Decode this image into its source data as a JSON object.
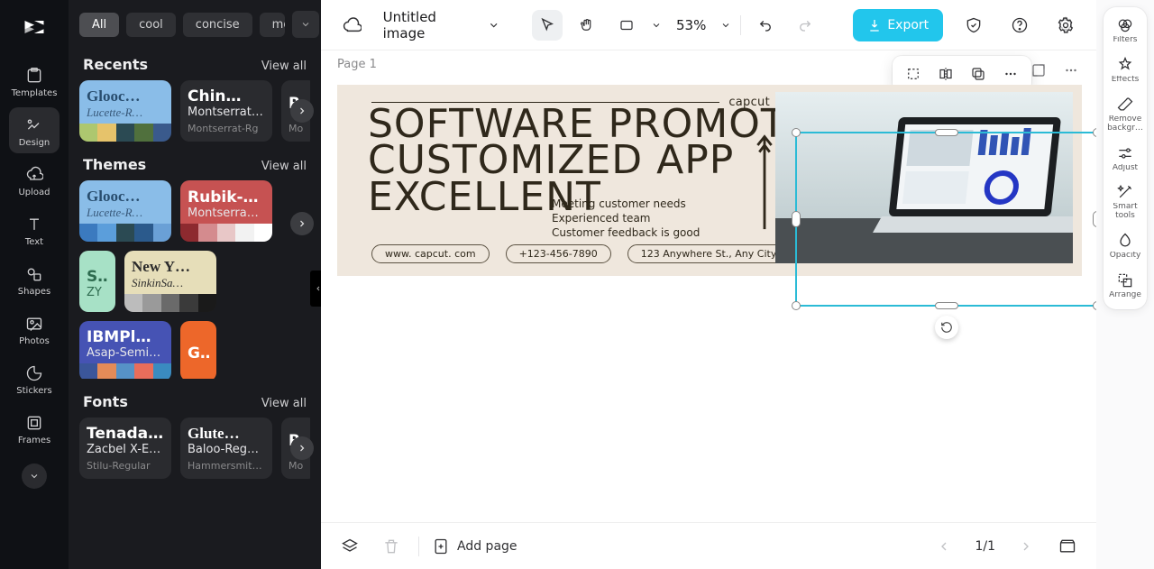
{
  "nav": {
    "items": [
      {
        "label": "Templates"
      },
      {
        "label": "Design"
      },
      {
        "label": "Upload"
      },
      {
        "label": "Text"
      },
      {
        "label": "Shapes"
      },
      {
        "label": "Photos"
      },
      {
        "label": "Stickers"
      },
      {
        "label": "Frames"
      }
    ],
    "active": "Design"
  },
  "chips": {
    "All": "All",
    "cool": "cool",
    "concise": "concise",
    "modern": "modern"
  },
  "sections": {
    "recents_title": "Recents",
    "themes_title": "Themes",
    "fonts_title": "Fonts",
    "view_all": "View all"
  },
  "recents": [
    {
      "title": "Glooc…",
      "sub": "Lucette-R…",
      "meta": "",
      "pal": [
        "#adc76f",
        "#e6c36b",
        "#2b4a53",
        "#50703d",
        "#3a5a8c"
      ]
    },
    {
      "title": "Chin…",
      "sub": "Montserrat-…",
      "meta": "Montserrat-Rg"
    },
    {
      "title": "Ru…",
      "sub": "",
      "meta": "Mo"
    }
  ],
  "themes": [
    {
      "title": "Glooc…",
      "sub": "Lucette-R…",
      "pal": [
        "#3b7abf",
        "#5b9edb",
        "#2b4a53",
        "#2b5a8c",
        "#6aa0d6"
      ]
    },
    {
      "title": "Rubik-…",
      "sub": "Montserra…",
      "pal": [
        "#8d2a2f",
        "#d48b8e",
        "#e8c7c7",
        "#f2f2f2",
        "#ffffff"
      ]
    },
    {
      "title": "Sp…",
      "sub": "ZY"
    },
    {
      "title": "New Y…",
      "sub": "SinkinSa…",
      "pal": [
        "#bcbcbc",
        "#9a9a9a",
        "#6a6a6a",
        "#3a3a3a",
        "#1a1a1a"
      ]
    },
    {
      "title": "IBMPl…",
      "sub": "Asap-SemiB…",
      "pal": [
        "#3b569a",
        "#e48b58",
        "#5692c7",
        "#e86d5b",
        "#3a8bc0"
      ]
    },
    {
      "title": "Gra…",
      "sub": ""
    }
  ],
  "fonts": [
    {
      "title": "Tenada-…",
      "sub": "Zacbel X-E…",
      "meta": "Stilu-Regular"
    },
    {
      "title": "Glute…",
      "sub": "Baloo-Reg…",
      "meta": "HammersmithOn…"
    },
    {
      "title": "Ru…",
      "sub": "",
      "meta": "Mo"
    }
  ],
  "topbar": {
    "title": "Untitled image",
    "zoom": "53%",
    "export": "Export"
  },
  "canvas": {
    "page_label": "Page 1"
  },
  "banner": {
    "brand": "capcut",
    "h1": "SOFTWARE PROMOTION",
    "h2": "CUSTOMIZED APP",
    "h3": "EXCELLENT",
    "bullet1": "Meeting customer needs",
    "bullet2": "Experienced team",
    "bullet3": "Customer feedback is good",
    "p1": "www. capcut. com",
    "p2": "+123-456-7890",
    "p3": "123 Anywhere St., Any City"
  },
  "bottombar": {
    "add_page": "Add page",
    "page": "1/1"
  },
  "prail": {
    "filters": "Filters",
    "effects": "Effects",
    "removebg": "Remove backgr…",
    "adjust": "Adjust",
    "smart": "Smart tools",
    "opacity": "Opacity",
    "arrange": "Arrange"
  }
}
